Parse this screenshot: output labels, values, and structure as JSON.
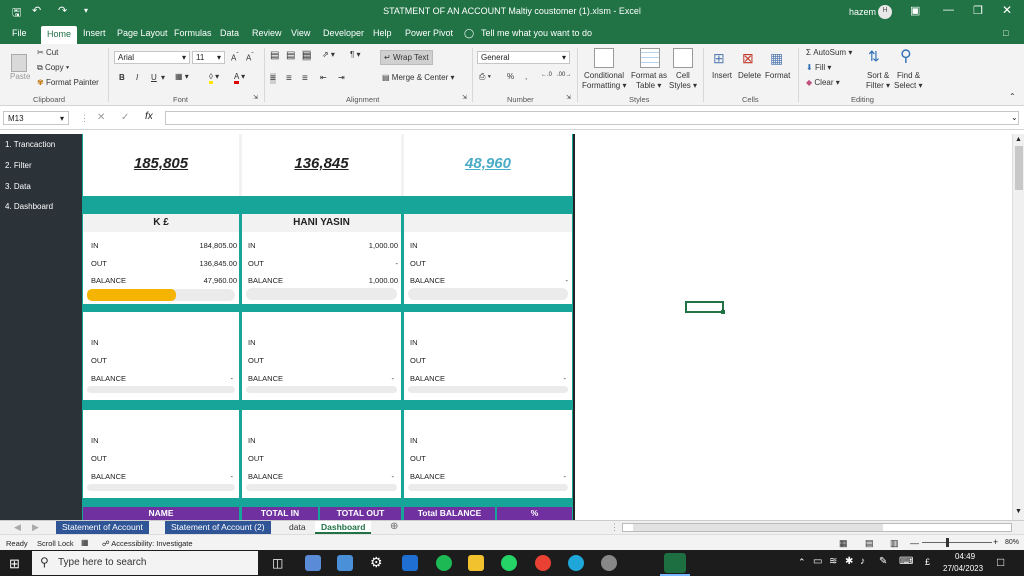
{
  "titlebar": {
    "title": "STATMENT OF AN ACCOUNT Maltiy coustomer (1).xlsm  -  Excel",
    "user": "hazem",
    "avatar": "H"
  },
  "ribbon_tabs": [
    "File",
    "Home",
    "Insert",
    "Page Layout",
    "Formulas",
    "Data",
    "Review",
    "Developer",
    "Help",
    "Power Pivot"
  ],
  "tell_me": "Tell me what you want to do",
  "clipboard": {
    "paste": "Paste",
    "cut": "Cut",
    "copy": "Copy",
    "format_painter": "Format Painter",
    "group": "Clipboard"
  },
  "font": {
    "name": "Arial",
    "size": "11",
    "group": "Font"
  },
  "alignment": {
    "wrap": "Wrap Text",
    "merge": "Merge & Center",
    "group": "Alignment"
  },
  "number": {
    "format": "General",
    "group": "Number"
  },
  "styles": {
    "conditional": "Conditional",
    "formatting": "Formatting",
    "format_as": "Format as",
    "table": "Table",
    "cell": "Cell",
    "cell_styles": "Styles",
    "group": "Styles"
  },
  "cells": {
    "insert": "Insert",
    "delete": "Delete",
    "format": "Format",
    "group": "Cells"
  },
  "editing": {
    "autosum": "AutoSum",
    "fill": "Fill",
    "clear": "Clear",
    "sort": "Sort &",
    "filter": "Filter",
    "find": "Find &",
    "select": "Select",
    "group": "Editing"
  },
  "namebox": "M13",
  "nav": [
    "1. Trancaction",
    "2. Filter",
    "3. Data",
    "4. Dashboard"
  ],
  "totals": [
    "185,805",
    "136,845",
    "48,960"
  ],
  "card1": {
    "title": "K £",
    "in_label": "IN",
    "in": "184,805.00",
    "out_label": "OUT",
    "out": "136,845.00",
    "balance_label": "BALANCE",
    "balance": "47,960.00",
    "progress": 0.6
  },
  "card2": {
    "title": "HANI YASIN",
    "in_label": "IN",
    "in": "1,000.00",
    "out_label": "OUT",
    "out": "-",
    "balance_label": "BALANCE",
    "balance": "1,000.00"
  },
  "card3": {
    "in_label": "IN",
    "out_label": "OUT",
    "balance_label": "BALANCE",
    "balance": "-"
  },
  "card4": {
    "in_label": "IN",
    "out_label": "OUT",
    "balance_label": "BALANCE",
    "balance": "-"
  },
  "card5": {
    "in_label": "IN",
    "out_label": "OUT",
    "balance_label": "BALANCE",
    "balance": "-"
  },
  "card6": {
    "in_label": "IN",
    "out_label": "OUT",
    "balance_label": "BALANCE",
    "balance": "-"
  },
  "card7": {
    "in_label": "IN",
    "out_label": "OUT",
    "balance_label": "BALANCE",
    "balance": "-"
  },
  "card8": {
    "in_label": "IN",
    "out_label": "OUT",
    "balance_label": "BALANCE",
    "balance": "-"
  },
  "card9": {
    "in_label": "IN",
    "out_label": "OUT",
    "balance_label": "BALANCE",
    "balance": "-"
  },
  "table_headers": [
    "NAME",
    "TOTAL IN",
    "TOTAL OUT",
    "Total BALANCE",
    "%"
  ],
  "sheet_tabs": [
    "Statement of Account",
    "Statement of Account (2)",
    "data",
    "Dashboard"
  ],
  "status": {
    "ready": "Ready",
    "scroll": "Scroll Lock",
    "access": "Accessibility: Investigate",
    "zoom": "80%"
  },
  "taskbar": {
    "search": "Type here to search",
    "time": "04:49",
    "date": "27/04/2023"
  },
  "colors": {
    "excel_green": "#217346",
    "teal": "#17a59a",
    "purple": "#7030a0",
    "gold": "#f5b400",
    "total3": "#4bacc6"
  }
}
